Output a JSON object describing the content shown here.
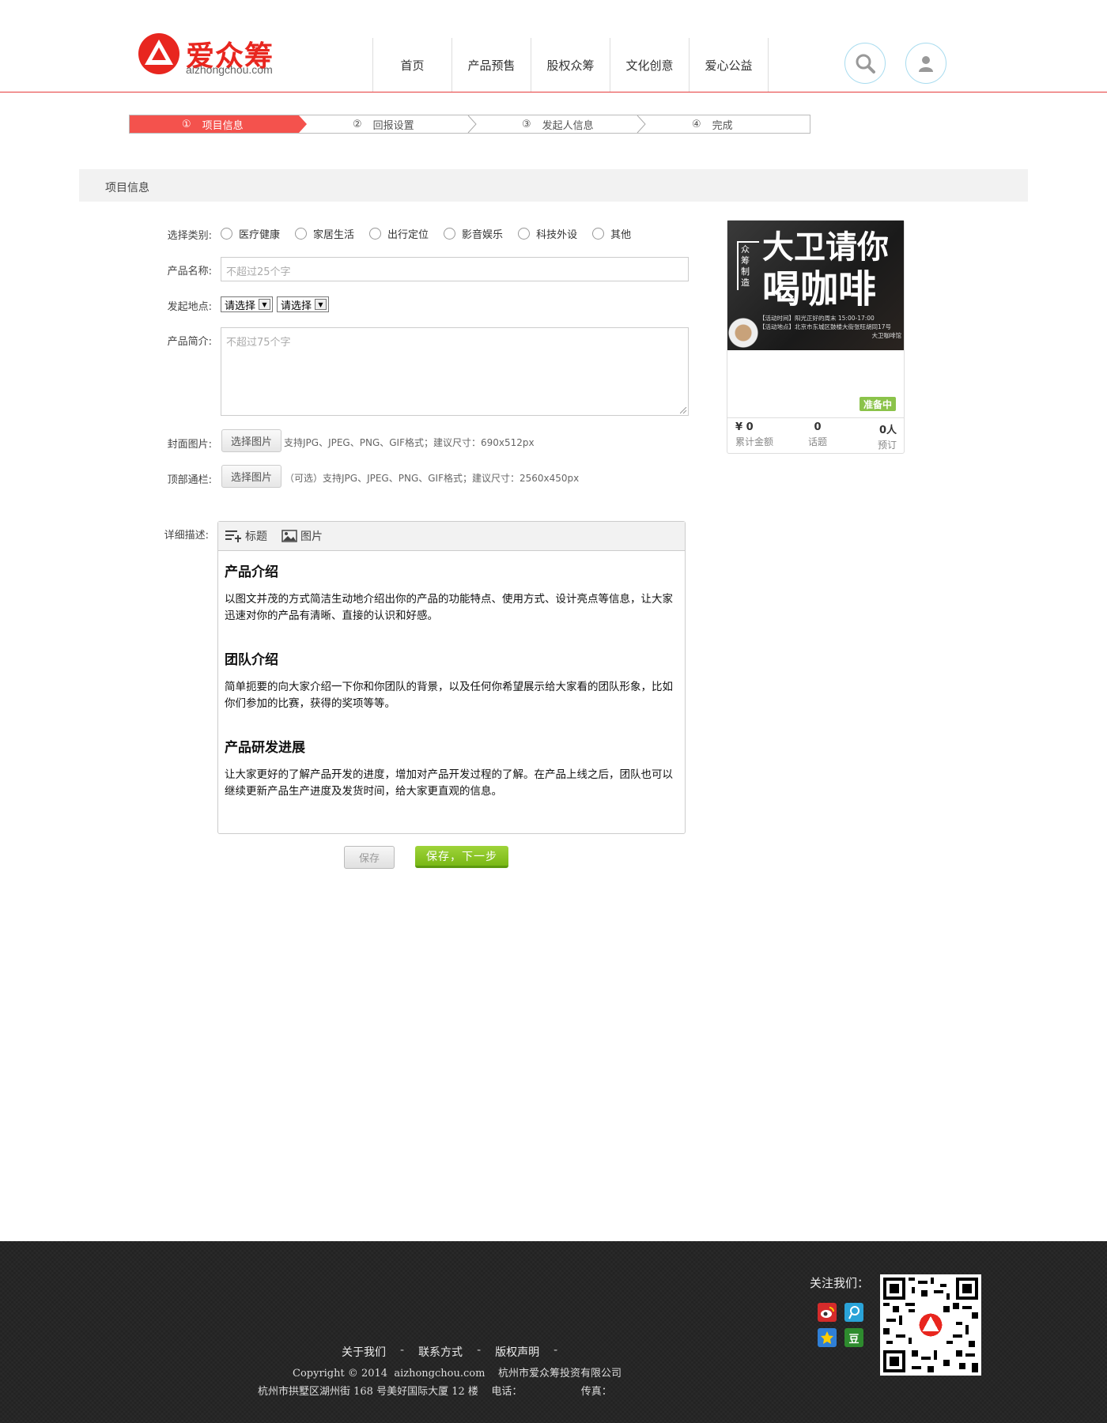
{
  "header": {
    "logo_text": "爱众筹",
    "logo_sub": "aizhongchou.com",
    "nav": [
      "首页",
      "产品预售",
      "股权众筹",
      "文化创意",
      "爱心公益"
    ],
    "search_icon": "search-icon",
    "user_icon": "user-icon"
  },
  "steps": [
    {
      "num": "①",
      "label": "项目信息",
      "active": true
    },
    {
      "num": "②",
      "label": "回报设置",
      "active": false
    },
    {
      "num": "③",
      "label": "发起人信息",
      "active": false
    },
    {
      "num": "④",
      "label": "完成",
      "active": false
    }
  ],
  "section_title": "项目信息",
  "form": {
    "category_label": "选择类别:",
    "categories": [
      "医疗健康",
      "家居生活",
      "出行定位",
      "影音娱乐",
      "科技外设",
      "其他"
    ],
    "name_label": "产品名称:",
    "name_placeholder": "不超过25个字",
    "location_label": "发起地点:",
    "province_select": "请选择",
    "city_select": "请选择",
    "intro_label": "产品简介:",
    "intro_placeholder": "不超过75个字",
    "cover_label": "封面图片:",
    "cover_button": "选择图片",
    "cover_hint": "支持JPG、JPEG、PNG、GIF格式；建议尺寸：690x512px",
    "banner_label": "顶部通栏:",
    "banner_button": "选择图片",
    "banner_hint": "（可选）支持JPG、JPEG、PNG、GIF格式；建议尺寸：2560x450px",
    "detail_label": "详细描述:"
  },
  "editor": {
    "tool_heading": "标题",
    "tool_image": "图片",
    "sections": [
      {
        "title": "产品介绍",
        "text": "以图文并茂的方式简洁生动地介绍出你的产品的功能特点、使用方式、设计亮点等信息，让大家迅速对你的产品有清晰、直接的认识和好感。"
      },
      {
        "title": "团队介绍",
        "text": "简单扼要的向大家介绍一下你和你团队的背景，以及任何你希望展示给大家看的团队形象，比如你们参加的比赛，获得的奖项等等。"
      },
      {
        "title": "产品研发进展",
        "text": "让大家更好的了解产品开发的进度，增加对产品开发过程的了解。在产品上线之后，团队也可以继续更新产品生产进度及发货时间，给大家更直观的信息。"
      }
    ]
  },
  "buttons": {
    "save": "保存",
    "save_next": "保存，下一步"
  },
  "preview": {
    "img_tag_1": "众筹",
    "img_tag_2": "制造",
    "img_title_1": "大卫请你",
    "img_title_2": "喝咖啡",
    "img_line_1": "【活动时间】阳光正好的周末 15:00-17:00",
    "img_line_2": "【活动地点】北京市东城区鼓楼大街张旺胡同17号",
    "img_line_3": "大卫咖啡馆",
    "status": "准备中",
    "amount": "¥ 0",
    "amount_label": "累计金额",
    "topics": "0",
    "topics_label": "话题",
    "backers": "0人",
    "backers_label": "预订"
  },
  "footer": {
    "links": [
      "关于我们",
      "联系方式",
      "版权声明"
    ],
    "copyright": "Copyright © 2014  aizhongchou.com    杭州市爱众筹投资有限公司",
    "address": "杭州市拱墅区湖州街 168 号美好国际大厦 12 楼    电话：                  传真：",
    "follow": "关注我们：",
    "social_icons": [
      "weibo-icon",
      "tencent-weibo-icon",
      "qzone-icon",
      "douban-icon"
    ],
    "douban_glyph": "豆"
  }
}
